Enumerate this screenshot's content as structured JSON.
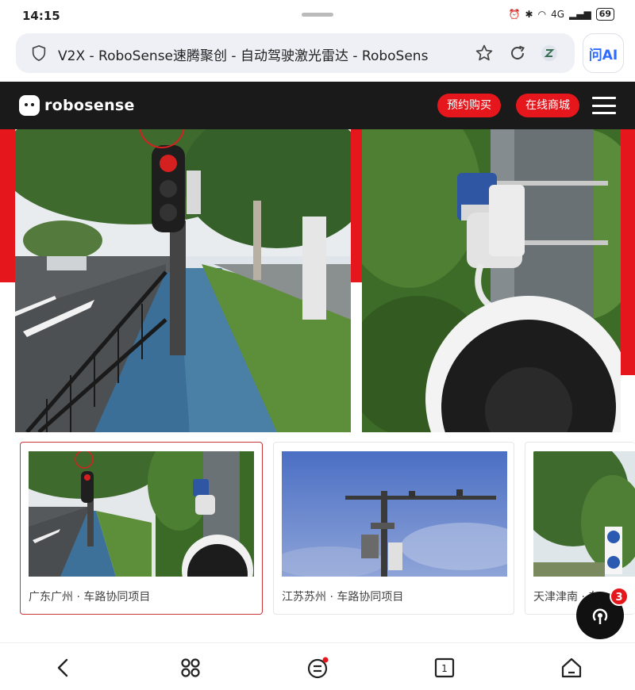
{
  "status_bar": {
    "time": "14:15",
    "network": "4G",
    "battery": "69"
  },
  "browser": {
    "url_text": "V2X - RoboSense速腾聚创 - 自动驾驶激光雷达 - RoboSens",
    "ai_button_label": "问AI"
  },
  "site_header": {
    "logo_text": "robosense",
    "preorder_label": "预约购买",
    "shop_label": "在线商城"
  },
  "projects": [
    {
      "caption": "广东广州 · 车路协同项目",
      "selected": true
    },
    {
      "caption": "江苏苏州 · 车路协同项目",
      "selected": false
    },
    {
      "caption": "天津津南 · 车",
      "selected": false
    }
  ],
  "fab": {
    "badge_count": "3"
  },
  "colors": {
    "brand_red": "#e5171c",
    "header_bg": "#1a1a1a",
    "selected_border": "#c9363a"
  },
  "icons": [
    "shield-icon",
    "star-icon",
    "refresh-icon",
    "extension-icon",
    "menu-icon",
    "back-icon",
    "apps-icon",
    "menu-dot-icon",
    "tabs-icon",
    "home-icon",
    "share-icon"
  ]
}
